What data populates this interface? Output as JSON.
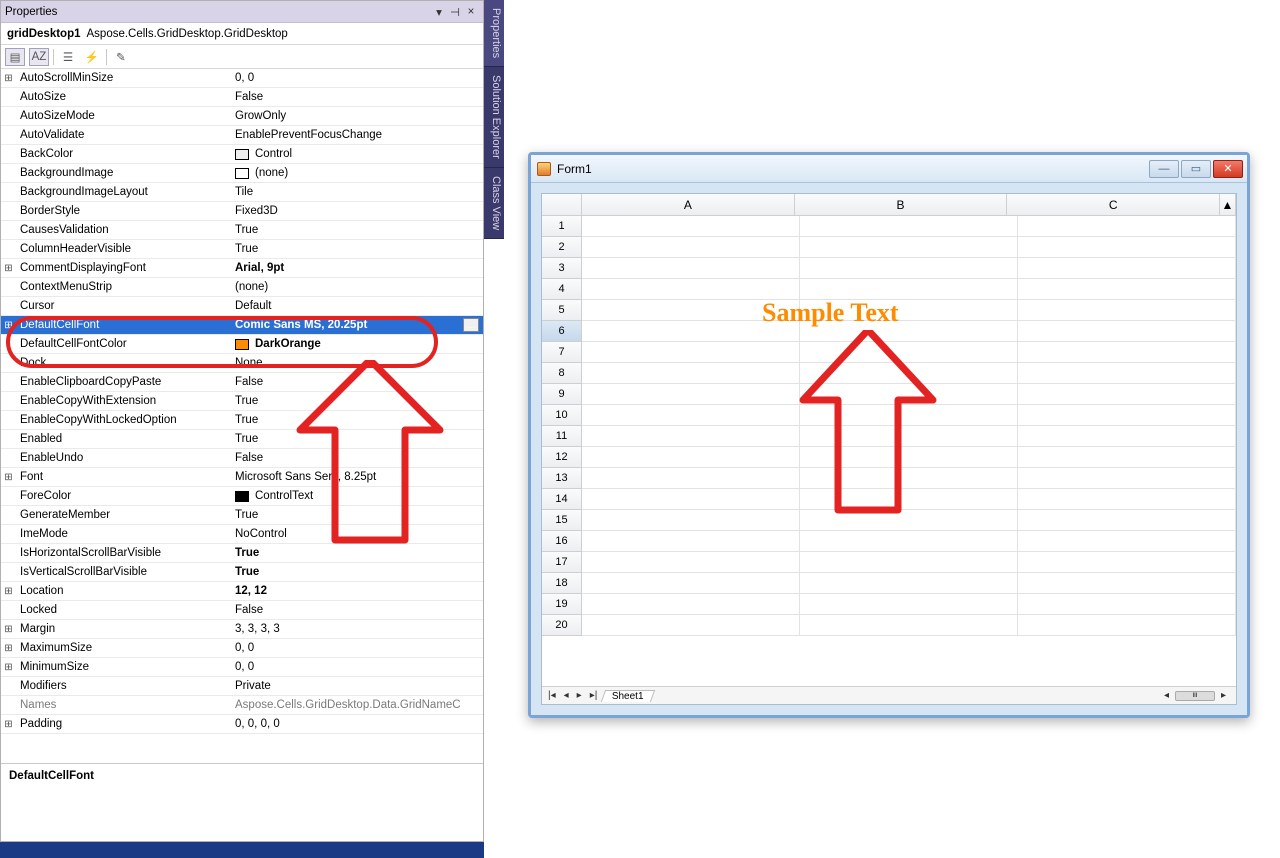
{
  "panel": {
    "title": "Properties",
    "object_name": "gridDesktop1",
    "object_type": "Aspose.Cells.GridDesktop.GridDesktop"
  },
  "sidetabs": [
    "Properties",
    "Solution Explorer",
    "Class View"
  ],
  "props": [
    {
      "exp": "⊞",
      "k": "AutoScrollMinSize",
      "v": "0, 0"
    },
    {
      "exp": "",
      "k": "AutoSize",
      "v": "False"
    },
    {
      "exp": "",
      "k": "AutoSizeMode",
      "v": "GrowOnly"
    },
    {
      "exp": "",
      "k": "AutoValidate",
      "v": "EnablePreventFocusChange"
    },
    {
      "exp": "",
      "k": "BackColor",
      "v": "Control",
      "swatch": "#eeeeee"
    },
    {
      "exp": "",
      "k": "BackgroundImage",
      "v": "(none)",
      "swatch": "#ffffff"
    },
    {
      "exp": "",
      "k": "BackgroundImageLayout",
      "v": "Tile"
    },
    {
      "exp": "",
      "k": "BorderStyle",
      "v": "Fixed3D"
    },
    {
      "exp": "",
      "k": "CausesValidation",
      "v": "True"
    },
    {
      "exp": "",
      "k": "ColumnHeaderVisible",
      "v": "True"
    },
    {
      "exp": "⊞",
      "k": "CommentDisplayingFont",
      "v": "Arial, 9pt",
      "bold": true
    },
    {
      "exp": "",
      "k": "ContextMenuStrip",
      "v": "(none)"
    },
    {
      "exp": "",
      "k": "Cursor",
      "v": "Default"
    },
    {
      "exp": "⊞",
      "k": "DefaultCellFont",
      "v": "Comic Sans MS, 20.25pt",
      "bold": true,
      "selected": true,
      "elide": true
    },
    {
      "exp": "",
      "k": "DefaultCellFontColor",
      "v": "DarkOrange",
      "swatch": "#ff8c00",
      "bold": true
    },
    {
      "exp": "",
      "k": "Dock",
      "v": "None"
    },
    {
      "exp": "",
      "k": "EnableClipboardCopyPaste",
      "v": "False"
    },
    {
      "exp": "",
      "k": "EnableCopyWithExtension",
      "v": "True"
    },
    {
      "exp": "",
      "k": "EnableCopyWithLockedOption",
      "v": "True"
    },
    {
      "exp": "",
      "k": "Enabled",
      "v": "True"
    },
    {
      "exp": "",
      "k": "EnableUndo",
      "v": "False"
    },
    {
      "exp": "⊞",
      "k": "Font",
      "v": "Microsoft Sans Serif, 8.25pt"
    },
    {
      "exp": "",
      "k": "ForeColor",
      "v": "ControlText",
      "swatch": "#000000"
    },
    {
      "exp": "",
      "k": "GenerateMember",
      "v": "True"
    },
    {
      "exp": "",
      "k": "ImeMode",
      "v": "NoControl"
    },
    {
      "exp": "",
      "k": "IsHorizontalScrollBarVisible",
      "v": "True",
      "bold": true
    },
    {
      "exp": "",
      "k": "IsVerticalScrollBarVisible",
      "v": "True",
      "bold": true
    },
    {
      "exp": "⊞",
      "k": "Location",
      "v": "12, 12",
      "bold": true
    },
    {
      "exp": "",
      "k": "Locked",
      "v": "False"
    },
    {
      "exp": "⊞",
      "k": "Margin",
      "v": "3, 3, 3, 3"
    },
    {
      "exp": "⊞",
      "k": "MaximumSize",
      "v": "0, 0"
    },
    {
      "exp": "⊞",
      "k": "MinimumSize",
      "v": "0, 0"
    },
    {
      "exp": "",
      "k": "Modifiers",
      "v": "Private"
    },
    {
      "exp": "",
      "k": "Names",
      "v": "Aspose.Cells.GridDesktop.Data.GridNameC",
      "gray": true
    },
    {
      "exp": "⊞",
      "k": "Padding",
      "v": "0, 0, 0, 0"
    }
  ],
  "desc_title": "DefaultCellFont",
  "form": {
    "title": "Form1",
    "columns": [
      "A",
      "B",
      "C"
    ],
    "rows": [
      "1",
      "2",
      "3",
      "4",
      "5",
      "6",
      "7",
      "8",
      "9",
      "10",
      "11",
      "12",
      "13",
      "14",
      "15",
      "16",
      "17",
      "18",
      "19",
      "20"
    ],
    "selected_row": "6",
    "sample_text": "Sample Text",
    "sheet_tab": "Sheet1",
    "scroll_mark": "III"
  },
  "ellipsis": "...",
  "icons": {
    "pin": "▾",
    "dd": "▸",
    "x": "×",
    "close": "✕",
    "min": "—",
    "max": "▭",
    "left": "◂",
    "right": "▸",
    "dleft": "◂◂",
    "dright": "▸▸",
    "vtop": "▲"
  }
}
